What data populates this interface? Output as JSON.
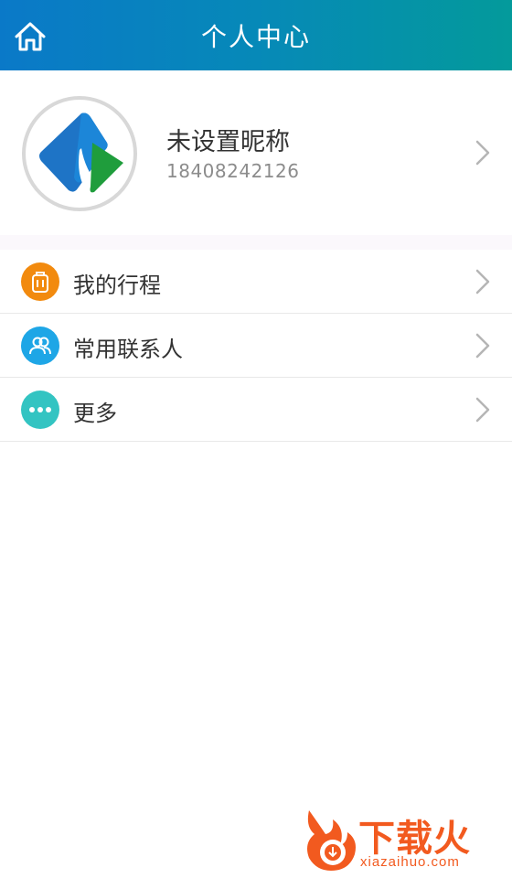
{
  "header": {
    "title": "个人中心",
    "home_icon": "home-icon"
  },
  "profile": {
    "nickname": "未设置昵称",
    "phone": "18408242126",
    "avatar_icon": "app-logo-icon"
  },
  "menu": {
    "items": [
      {
        "label": "我的行程",
        "icon": "luggage-icon",
        "color": "#f28a0e"
      },
      {
        "label": "常用联系人",
        "icon": "contacts-icon",
        "color": "#1ea6e6"
      },
      {
        "label": "更多",
        "icon": "more-dots-icon",
        "color": "#33c4c2"
      }
    ]
  },
  "watermark": {
    "brand": "下载火",
    "site": "xiazaihuo.com"
  },
  "colors": {
    "header_start": "#0a79c8",
    "header_end": "#049a9b",
    "text_primary": "#333333",
    "text_secondary": "#8c8c8c"
  }
}
